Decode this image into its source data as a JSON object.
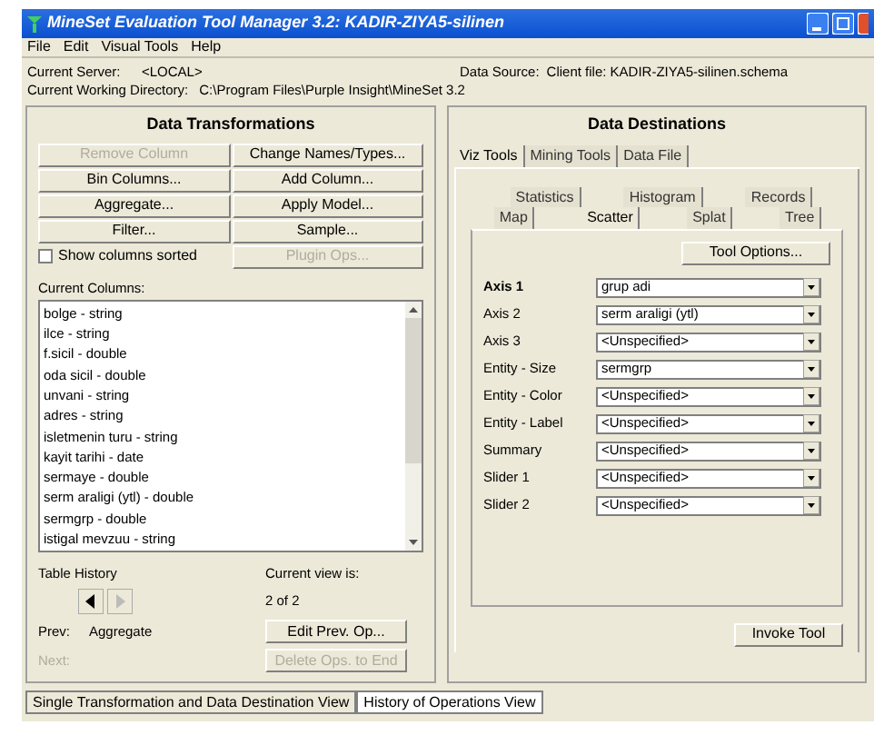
{
  "window": {
    "title": "MineSet Evaluation Tool Manager 3.2: KADIR-ZIYA5-silinen"
  },
  "menu": [
    "File",
    "Edit",
    "Visual Tools",
    "Help"
  ],
  "info": {
    "server_label": "Current Server:",
    "server": "<LOCAL>",
    "source_label": "Data Source:",
    "source": "Client file: KADIR-ZIYA5-silinen.schema",
    "dir_label": "Current Working Directory:",
    "dir": "C:\\Program Files\\Purple Insight\\MineSet 3.2"
  },
  "transformations": {
    "title": "Data Transformations",
    "buttons": [
      {
        "label": "Remove Column",
        "disabled": true
      },
      {
        "label": "Change Names/Types...",
        "disabled": false
      },
      {
        "label": "Bin Columns...",
        "disabled": false
      },
      {
        "label": "Add Column...",
        "disabled": false
      },
      {
        "label": "Aggregate...",
        "disabled": false
      },
      {
        "label": "Apply Model...",
        "disabled": false
      },
      {
        "label": "Filter...",
        "disabled": false
      },
      {
        "label": "Sample...",
        "disabled": false
      }
    ],
    "sort_checkbox": {
      "label": "Show columns sorted",
      "checked": false
    },
    "plugin_button": {
      "label": "Plugin Ops...",
      "disabled": true
    },
    "columns_label": "Current Columns:",
    "columns": [
      "bolge - string",
      "ilce - string",
      "f.sicil - double",
      "oda sicil - double",
      "unvani - string",
      "adres - string",
      "isletmenin turu - string",
      "kayit tarihi - date",
      "sermaye - double",
      "serm araligi (ytl) - double",
      "sermgrp - double",
      "istigal mevzuu - string"
    ],
    "history_label": "Table History",
    "current_view_label": "Current view is:",
    "current_view": "2 of 2",
    "prev_label": "Prev:",
    "prev_value": "Aggregate",
    "next_label": "Next:",
    "next_disabled": true,
    "edit_button": {
      "label": "Edit Prev. Op...",
      "disabled": false
    },
    "delete_button": {
      "label": "Delete Ops. to End",
      "disabled": true
    }
  },
  "destinations": {
    "title": "Data Destinations",
    "tabs": [
      {
        "label": "Viz Tools",
        "selected": true
      },
      {
        "label": "Mining Tools",
        "selected": false
      },
      {
        "label": "Data File",
        "selected": false
      }
    ],
    "tool_tabs_back": [
      {
        "label": "Statistics",
        "selected": false
      },
      {
        "label": "Histogram",
        "selected": false
      },
      {
        "label": "Records",
        "selected": false
      }
    ],
    "tool_tabs_front": [
      {
        "label": "Map",
        "selected": false
      },
      {
        "label": "Scatter",
        "selected": true
      },
      {
        "label": "Splat",
        "selected": false
      },
      {
        "label": "Tree",
        "selected": false
      }
    ],
    "tool_options": "Tool Options...",
    "fields": [
      {
        "label": "Axis 1",
        "value": "grup adi",
        "bold": true
      },
      {
        "label": "Axis 2",
        "value": "serm araligi (ytl)",
        "bold": false
      },
      {
        "label": "Axis 3",
        "value": "<Unspecified>",
        "bold": false
      },
      {
        "label": "Entity - Size",
        "value": "sermgrp",
        "bold": false
      },
      {
        "label": "Entity - Color",
        "value": "<Unspecified>",
        "bold": false
      },
      {
        "label": "Entity - Label",
        "value": "<Unspecified>",
        "bold": false
      },
      {
        "label": "Summary",
        "value": "<Unspecified>",
        "bold": false
      },
      {
        "label": "Slider 1",
        "value": "<Unspecified>",
        "bold": false
      },
      {
        "label": "Slider 2",
        "value": "<Unspecified>",
        "bold": false
      }
    ],
    "invoke": "Invoke Tool"
  },
  "view_tabs": [
    {
      "label": "Single Transformation and Data Destination View",
      "selected": true
    },
    {
      "label": "History of Operations View",
      "selected": false
    }
  ]
}
